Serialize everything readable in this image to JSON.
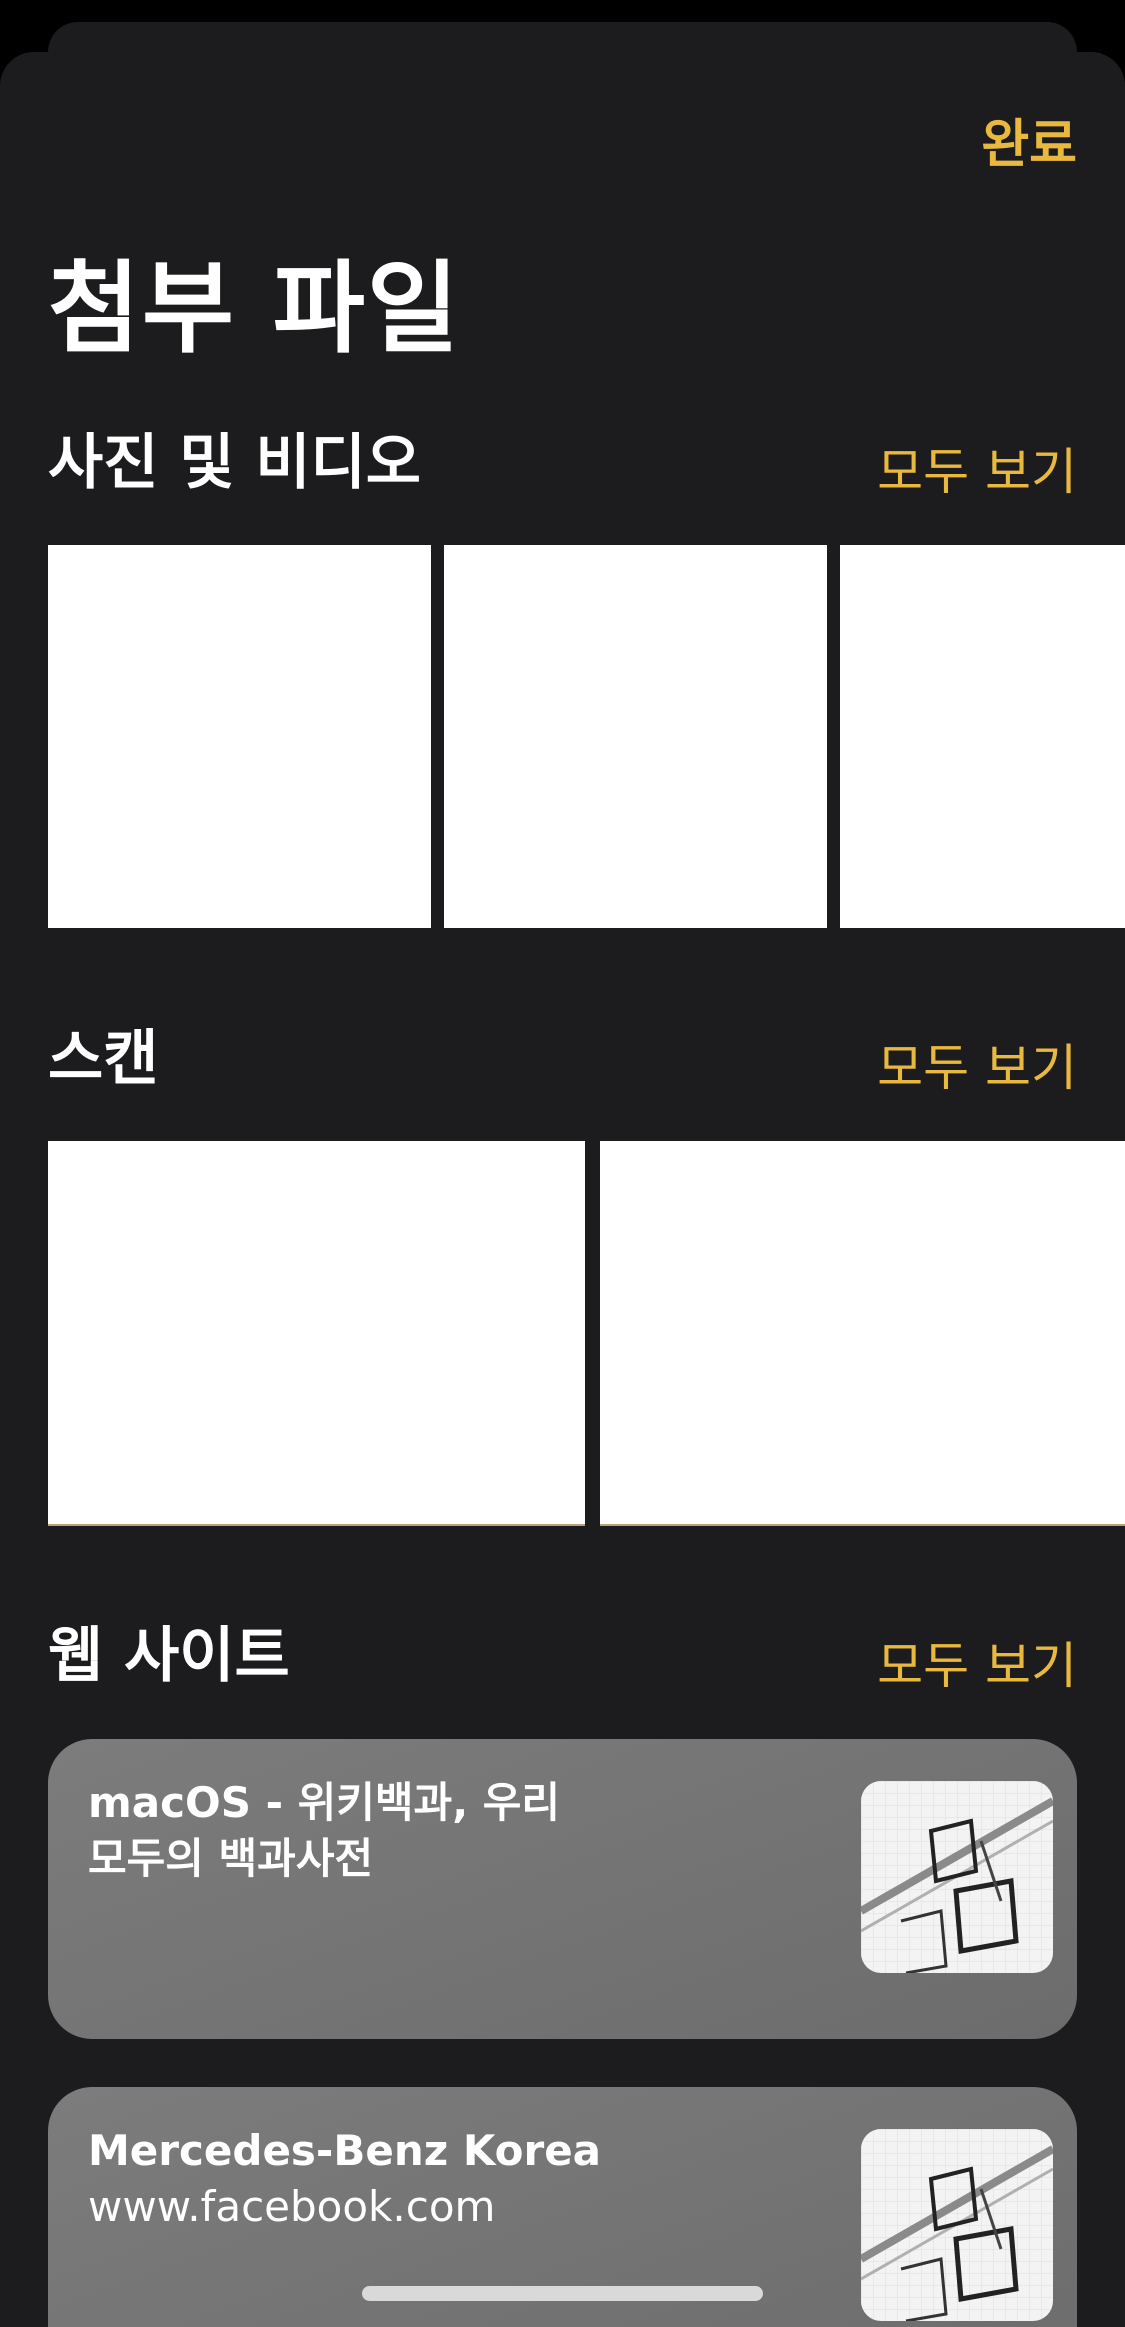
{
  "header": {
    "done_label": "완료",
    "title": "첨부 파일"
  },
  "sections": {
    "photos": {
      "title": "사진 및 비디오",
      "see_all": "모두 보기"
    },
    "scans": {
      "title": "스캔",
      "see_all": "모두 보기"
    },
    "websites": {
      "title": "웹 사이트",
      "see_all": "모두 보기"
    }
  },
  "websites": [
    {
      "title_line1": "macOS - 위키백과, 우리",
      "title_line2": "모두의 백과사전"
    },
    {
      "title_line1": "Mercedes-Benz Korea",
      "title_line2": "www.facebook.com"
    }
  ],
  "colors": {
    "accent": "#e8b93e",
    "sheet_background": "#1c1c1e",
    "card_background": "#747474"
  },
  "icons": {
    "web_thumbnail": "sketch-drawing-thumbnail"
  }
}
